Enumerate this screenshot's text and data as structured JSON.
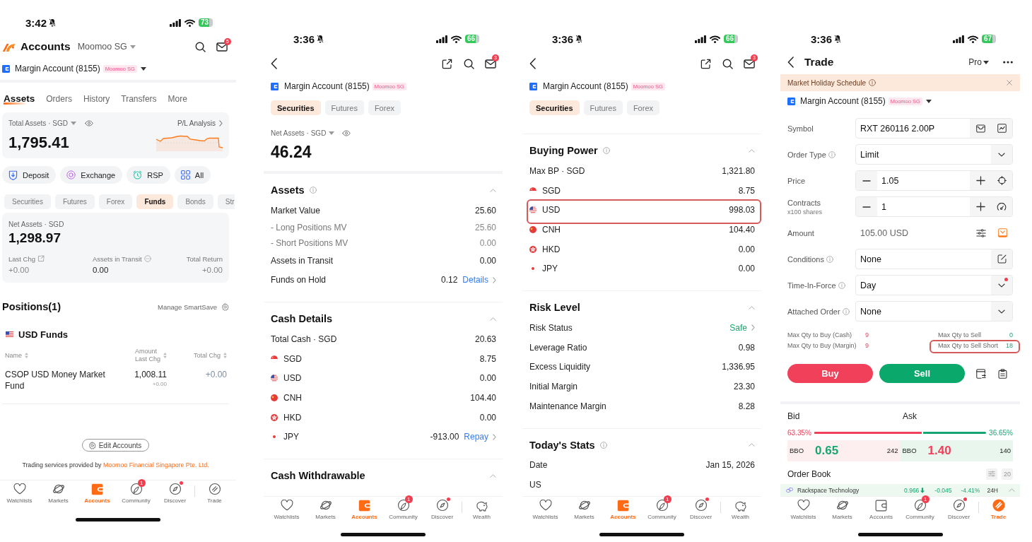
{
  "screens": [
    {
      "kind": "accounts",
      "status_bar": {
        "time": "3:42",
        "battery": "73"
      },
      "header": {
        "title": "Accounts",
        "broker": "Moomoo SG",
        "mail_badge": "5"
      },
      "account": {
        "name": "Margin Account (8155)",
        "tag": "Moomoo SG",
        "dropdown": true
      },
      "tabs": [
        {
          "label": "Assets",
          "selected": true
        },
        {
          "label": "Orders",
          "selected": false
        },
        {
          "label": "History",
          "selected": false
        },
        {
          "label": "Transfers",
          "selected": false
        },
        {
          "label": "More",
          "selected": false
        }
      ],
      "summary": {
        "label": "Total Assets · SGD",
        "value": "1,795.41",
        "link": "P/L Analysis"
      },
      "actions": [
        {
          "label": "Deposit"
        },
        {
          "label": "Exchange"
        },
        {
          "label": "RSP"
        },
        {
          "label": "All"
        }
      ],
      "segments": [
        {
          "label": "Securities",
          "selected": false
        },
        {
          "label": "Futures",
          "selected": false
        },
        {
          "label": "Forex",
          "selected": false
        },
        {
          "label": "Funds",
          "selected": true
        },
        {
          "label": "Bonds",
          "selected": false
        },
        {
          "label": "Str",
          "selected": false
        }
      ],
      "net_assets": {
        "label": "Net Assets · SGD",
        "value": "1,298.97",
        "stats": [
          {
            "kind": "change",
            "label": "Last Chg",
            "value": "+0.00"
          },
          {
            "kind": "amount",
            "label": "Assets in Transit",
            "value": "0.00"
          },
          {
            "kind": "change",
            "label": "Total Return",
            "value": "+0.00"
          }
        ]
      },
      "positions": {
        "title": "Positions(1)",
        "link": "Manage SmartSave",
        "group": {
          "kind": "usd",
          "label": "USD Funds"
        },
        "columns": [
          {
            "label": "Name"
          },
          {
            "label": "Amount",
            "sublabel": "Last Chg"
          },
          {
            "label": "Total Chg"
          }
        ],
        "rows": [
          {
            "name": "CSOP USD Money Market Fund",
            "amount": "1,008.11",
            "last_chg": "+0.00",
            "total_chg": "+0.00"
          }
        ]
      },
      "edit_button": "Edit Accounts",
      "footer": {
        "text": "Trading services provided by",
        "link": "Moomoo Financial Singapore Pte. Ltd."
      },
      "nav": [
        {
          "kind": "watchlists",
          "label": "Watchlists",
          "selected": false,
          "dot": false
        },
        {
          "kind": "markets",
          "label": "Markets",
          "selected": false,
          "dot": false
        },
        {
          "kind": "accounts",
          "label": "Accounts",
          "selected": true,
          "dot": false
        },
        {
          "kind": "community",
          "label": "Community",
          "selected": false,
          "dot": false,
          "badge": "1"
        },
        {
          "kind": "discover",
          "label": "Discover",
          "selected": false,
          "dot": true
        },
        {
          "kind": "trade",
          "label": "Trade",
          "selected": false,
          "dot": false
        }
      ]
    },
    {
      "kind": "account_detail",
      "status_bar": {
        "time": "3:36",
        "battery": "66"
      },
      "toolbar": {
        "mail_badge": "3"
      },
      "account": {
        "name": "Margin Account (8155)",
        "tag": "Moomoo SG",
        "dropdown": false
      },
      "segments": [
        {
          "label": "Securities",
          "selected": true
        },
        {
          "label": "Futures",
          "selected": false
        },
        {
          "label": "Forex",
          "selected": false
        }
      ],
      "net_assets": {
        "label": "Net Assets · SGD",
        "value": "46.24"
      },
      "sections": [
        {
          "title": "Assets",
          "info": true,
          "expanded": true,
          "rows": [
            {
              "kind": "main",
              "label": "Market Value",
              "value": "25.60"
            },
            {
              "kind": "sub",
              "label": "- Long Positions MV",
              "value": "25.60"
            },
            {
              "kind": "sub",
              "label": "- Short Positions MV",
              "value": "0.00"
            },
            {
              "kind": "main",
              "label": "Assets in Transit",
              "value": "0.00"
            },
            {
              "kind": "main",
              "label": "Funds on Hold",
              "value": "0.12",
              "link": "Details",
              "color": "#2f7cf6"
            }
          ]
        },
        {
          "title": "Cash Details",
          "info": false,
          "expanded": true,
          "rows": [
            {
              "kind": "main",
              "label": "Total Cash · SGD",
              "value": "20.63"
            },
            {
              "kind": "sgd",
              "label": "SGD",
              "value": "8.75"
            },
            {
              "kind": "usd",
              "label": "USD",
              "value": "0.00"
            },
            {
              "kind": "cnh",
              "label": "CNH",
              "value": "104.40"
            },
            {
              "kind": "hkd",
              "label": "HKD",
              "value": "0.00"
            },
            {
              "kind": "jpy",
              "label": "JPY",
              "value": "-913.00",
              "link": "Repay",
              "color": "#2f7cf6"
            }
          ]
        },
        {
          "title": "Cash Withdrawable",
          "info": false,
          "expanded": true
        }
      ],
      "nav": [
        {
          "kind": "watchlists",
          "label": "Watchlists",
          "selected": false,
          "dot": false
        },
        {
          "kind": "markets",
          "label": "Markets",
          "selected": false,
          "dot": false
        },
        {
          "kind": "accounts",
          "label": "Accounts",
          "selected": true,
          "dot": false
        },
        {
          "kind": "community",
          "label": "Community",
          "selected": false,
          "dot": false,
          "badge": "1"
        },
        {
          "kind": "discover",
          "label": "Discover",
          "selected": false,
          "dot": true
        },
        {
          "kind": "wealth",
          "label": "Wealth",
          "selected": false,
          "dot": false
        }
      ]
    },
    {
      "kind": "account_detail",
      "status_bar": {
        "time": "3:36",
        "battery": "66"
      },
      "toolbar": {
        "mail_badge": "3"
      },
      "account": {
        "name": "Margin Account (8155)",
        "tag": "Moomoo SG",
        "dropdown": false
      },
      "segments": [
        {
          "label": "Securities",
          "selected": true
        },
        {
          "label": "Futures",
          "selected": false
        },
        {
          "label": "Forex",
          "selected": false
        }
      ],
      "sections": [
        {
          "title": "Buying Power",
          "info": true,
          "expanded": true,
          "rows": [
            {
              "kind": "main",
              "label": "Max BP · SGD",
              "value": "1,321.80",
              "highlighted": false
            },
            {
              "kind": "sgd",
              "label": "SGD",
              "value": "8.75",
              "highlighted": false
            },
            {
              "kind": "usd",
              "label": "USD",
              "value": "998.03",
              "highlighted": true
            },
            {
              "kind": "cnh",
              "label": "CNH",
              "value": "104.40",
              "highlighted": false
            },
            {
              "kind": "hkd",
              "label": "HKD",
              "value": "0.00",
              "highlighted": false
            },
            {
              "kind": "jpy",
              "label": "JPY",
              "value": "0.00",
              "highlighted": false
            }
          ]
        },
        {
          "title": "Risk Level",
          "info": false,
          "expanded": true,
          "rows": [
            {
              "kind": "main",
              "label": "Risk Status",
              "link": "Safe",
              "color": "#17a66c"
            },
            {
              "kind": "main",
              "label": "Leverage Ratio",
              "value": "0.98"
            },
            {
              "kind": "main",
              "label": "Excess Liquidity",
              "value": "1,336.95"
            },
            {
              "kind": "main",
              "label": "Initial Margin",
              "value": "23.30"
            },
            {
              "kind": "main",
              "label": "Maintenance Margin",
              "value": "8.28"
            }
          ]
        },
        {
          "title": "Today's Stats",
          "info": true,
          "expanded": true,
          "rows": [
            {
              "kind": "main",
              "label": "Date",
              "value": "Jan 15, 2026"
            },
            {
              "kind": "main",
              "label": "US"
            }
          ]
        }
      ],
      "nav": [
        {
          "kind": "watchlists",
          "label": "Watchlists",
          "selected": false,
          "dot": false
        },
        {
          "kind": "markets",
          "label": "Markets",
          "selected": false,
          "dot": false
        },
        {
          "kind": "accounts",
          "label": "Accounts",
          "selected": true,
          "dot": false
        },
        {
          "kind": "community",
          "label": "Community",
          "selected": false,
          "dot": false,
          "badge": "1"
        },
        {
          "kind": "discover",
          "label": "Discover",
          "selected": false,
          "dot": true
        },
        {
          "kind": "wealth",
          "label": "Wealth",
          "selected": false,
          "dot": false
        }
      ]
    },
    {
      "kind": "trade",
      "status_bar": {
        "time": "3:36",
        "battery": "67"
      },
      "header": {
        "title": "Trade",
        "mode": "Pro"
      },
      "banner": {
        "text": "Market Holiday Schedule"
      },
      "account": {
        "name": "Margin Account (8155)",
        "tag": "Moomoo SG",
        "dropdown": true
      },
      "form": [
        {
          "kind": "symbol",
          "label": "Symbol",
          "info": false,
          "value": "RXT 260116 2.00P"
        },
        {
          "kind": "select",
          "label": "Order Type",
          "info": true,
          "value": "Limit",
          "dot": false
        },
        {
          "kind": "stepper",
          "label": "Price",
          "info": false,
          "value": "1.05"
        },
        {
          "kind": "stepper",
          "label": "Contracts",
          "sublabel": "x100 shares",
          "info": false,
          "value": "1"
        },
        {
          "kind": "amount",
          "label": "Amount",
          "info": false,
          "value": "105.00 USD"
        },
        {
          "kind": "edit",
          "label": "Conditions",
          "info": true,
          "value": "None"
        },
        {
          "kind": "select",
          "label": "Time-In-Force",
          "info": true,
          "value": "Day",
          "dot": true
        },
        {
          "kind": "select",
          "label": "Attached Order",
          "info": true,
          "value": "None",
          "dot": false
        }
      ],
      "limits": [
        {
          "kind": "buy",
          "label": "Max Qty to Buy (Cash)",
          "value": "9",
          "highlighted": false
        },
        {
          "kind": "sell",
          "label": "Max Qty to Sell",
          "value": "0",
          "highlighted": false
        },
        {
          "kind": "buy",
          "label": "Max Qty to Buy (Margin)",
          "value": "9",
          "highlighted": false
        },
        {
          "kind": "sell",
          "label": "Max Qty to Sell Short",
          "value": "18",
          "highlighted": true
        }
      ],
      "buttons": [
        {
          "kind": "buy",
          "label": "Buy"
        },
        {
          "kind": "sell",
          "label": "Sell"
        }
      ],
      "quote": {
        "bid_label": "Bid",
        "ask_label": "Ask",
        "bid_share": "63.35%",
        "ask_share": "36.65%",
        "level": 0.6335,
        "bbo": [
          {
            "kind": "bid",
            "label": "BBO",
            "price": "0.65",
            "size": "242"
          },
          {
            "kind": "ask",
            "label": "BBO",
            "price": "1.40",
            "size": "140"
          }
        ]
      },
      "order_book": {
        "title": "Order Book",
        "depth": "20"
      },
      "ticker": {
        "name": "Rackspace Technology",
        "price": "0.966",
        "change": "-0.045",
        "change_pct": "-4.41%",
        "session": "24H"
      },
      "nav": [
        {
          "kind": "watchlists",
          "label": "Watchlists",
          "selected": false,
          "dot": false
        },
        {
          "kind": "markets",
          "label": "Markets",
          "selected": false,
          "dot": false
        },
        {
          "kind": "accounts",
          "label": "Accounts",
          "selected": false,
          "dot": false
        },
        {
          "kind": "community",
          "label": "Community",
          "selected": false,
          "dot": false,
          "badge": "1"
        },
        {
          "kind": "discover",
          "label": "Discover",
          "selected": false,
          "dot": true
        },
        {
          "kind": "trade",
          "label": "Trade",
          "selected": true,
          "dot": false
        }
      ]
    }
  ]
}
